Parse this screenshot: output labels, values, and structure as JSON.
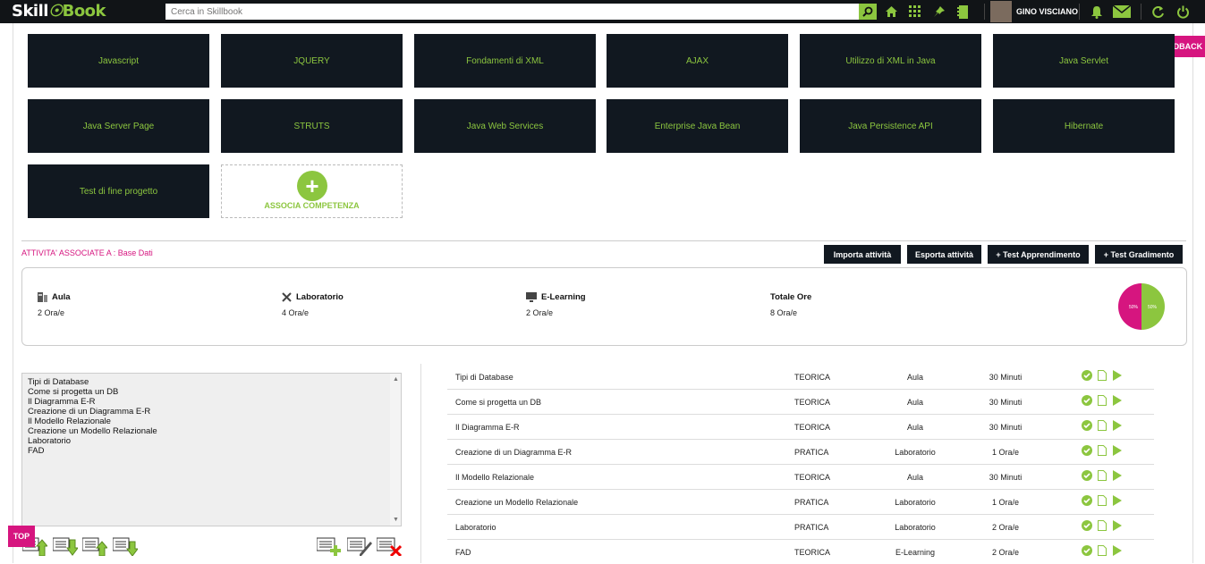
{
  "header": {
    "logo_part1": "Skill",
    "logo_part2": "Book",
    "search_placeholder": "Cerca in Skillbook",
    "user_name": "GINO VISCIANO",
    "icons": [
      "search-icon",
      "home-icon",
      "apps-grid-icon",
      "pin-icon",
      "notebook-icon",
      "bell-icon",
      "mail-icon",
      "refresh-icon",
      "power-icon"
    ]
  },
  "feedback_label": "INVIA FEEDBACK",
  "tiles": [
    "Javascript",
    "JQUERY",
    "Fondamenti di XML",
    "AJAX",
    "Utilizzo di XML in Java",
    "Java Servlet",
    "Java Server Page",
    "STRUTS",
    "Java Web Services",
    "Enterprise Java Bean",
    "Java Persistence API",
    "Hibernate",
    "Test di fine progetto"
  ],
  "add_tile_label": "ASSOCIA COMPETENZA",
  "activities_heading": "ATTIVITA' ASSOCIATE A : Base Dati",
  "actions": {
    "import": "Importa attività",
    "export": "Esporta attività",
    "test_learning": "+ Test Apprendimento",
    "test_satisfaction": "+ Test Gradimento"
  },
  "summary": {
    "aula_label": "Aula",
    "aula_value": "2 Ora/e",
    "lab_label": "Laboratorio",
    "lab_value": "4 Ora/e",
    "elearning_label": "E-Learning",
    "elearning_value": "2 Ora/e",
    "total_label": "Totale Ore",
    "total_value": "8 Ora/e",
    "pie": {
      "left_label": "50%",
      "right_label": "50%",
      "left_color": "#d6157f",
      "right_color": "#8cc63f",
      "left_value": 50,
      "right_value": 50
    }
  },
  "list_items": [
    "Tipi di Database",
    "Come si progetta un DB",
    "Il Diagramma E-R",
    "Creazione di un Diagramma E-R",
    "Il Modello Relazionale",
    "Creazione un Modello Relazionale",
    "Laboratorio",
    "FAD"
  ],
  "rows": [
    {
      "title": "Tipi di Database",
      "type": "TEORICA",
      "place": "Aula",
      "duration": "30 Minuti"
    },
    {
      "title": "Come si progetta un DB",
      "type": "TEORICA",
      "place": "Aula",
      "duration": "30 Minuti"
    },
    {
      "title": "Il Diagramma E-R",
      "type": "TEORICA",
      "place": "Aula",
      "duration": "30 Minuti"
    },
    {
      "title": "Creazione di un Diagramma E-R",
      "type": "PRATICA",
      "place": "Laboratorio",
      "duration": "1 Ora/e"
    },
    {
      "title": "Il Modello Relazionale",
      "type": "TEORICA",
      "place": "Aula",
      "duration": "30 Minuti"
    },
    {
      "title": "Creazione un Modello Relazionale",
      "type": "PRATICA",
      "place": "Laboratorio",
      "duration": "1 Ora/e"
    },
    {
      "title": "Laboratorio",
      "type": "PRATICA",
      "place": "Laboratorio",
      "duration": "2 Ora/e"
    },
    {
      "title": "FAD",
      "type": "TEORICA",
      "place": "E-Learning",
      "duration": "2 Ora/e"
    }
  ],
  "top_label": "TOP",
  "colors": {
    "accent_green": "#8cc63f",
    "accent_magenta": "#d6157f",
    "dark": "#111820"
  }
}
